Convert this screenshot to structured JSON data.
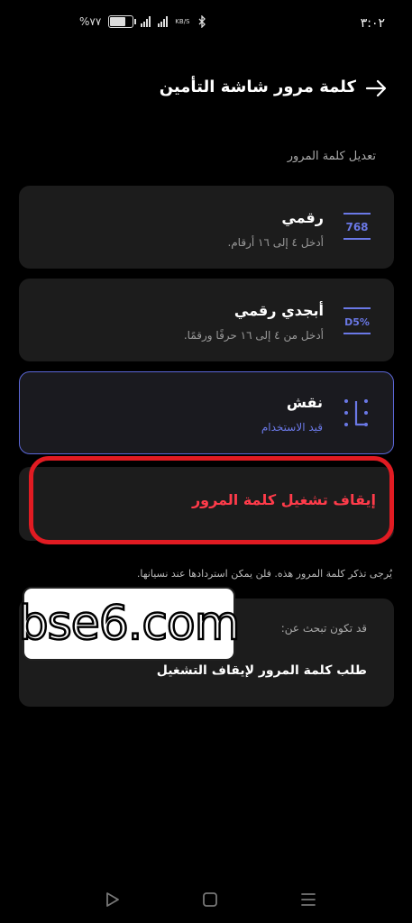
{
  "status_bar": {
    "time": "٣:٠٢",
    "battery_text": "%٧٧",
    "battery_level": 0.77,
    "speed_unit": "KB/S"
  },
  "header": {
    "title": "كلمة مرور شاشة التأمين",
    "back_icon": "arrow-right-icon"
  },
  "section_label": "تعديل كلمة المرور",
  "options": [
    {
      "title": "رقمي",
      "subtitle": "أدخل ٤ إلى ١٦ أرقام.",
      "icon_text": "768"
    },
    {
      "title": "أبجدي رقمي",
      "subtitle": "أدخل من ٤ إلى ١٦ حرفًا ورقمًا.",
      "icon_text": "D5%"
    },
    {
      "title": "نقش",
      "subtitle": "قيد الاستخدام",
      "icon": "pattern-icon",
      "selected": true
    }
  ],
  "stop_password": {
    "label": "إيقاف تشغيل كلمة المرور"
  },
  "note": "يُرجى تذكر كلمة المرور هذه. فلن يمكن استردادها عند نسيانها.",
  "suggestions": {
    "heading": "قد تكون تبحث عن:",
    "link": "طلب كلمة المرور لإيقاف التشغيل"
  },
  "watermark_text": "bse6.com",
  "colors": {
    "accent": "#5b67d8",
    "warning": "#ff3b4a",
    "highlight_ring": "#e11b22"
  }
}
